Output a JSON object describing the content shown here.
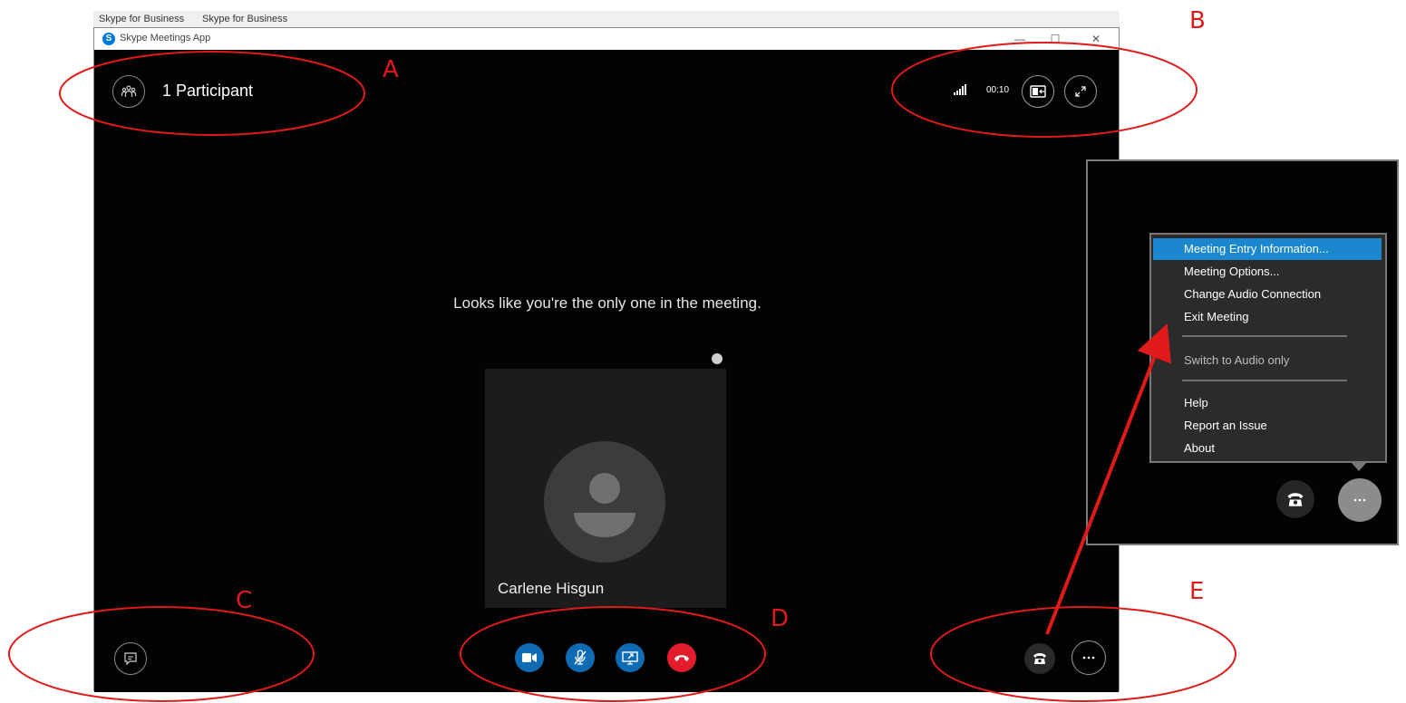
{
  "background_tabs": {
    "left_text": "Skype for Business",
    "right_text": "Skype for Business"
  },
  "window": {
    "title": "Skype Meetings App",
    "logo_letter": "S",
    "minimize": "—",
    "maximize": "☐",
    "close": "✕"
  },
  "header": {
    "participants_label": "1 Participant",
    "timer": "00:10",
    "icons": [
      "participants-icon",
      "signal-icon",
      "contact-card-icon",
      "expand-icon"
    ]
  },
  "main": {
    "empty_message": "Looks like you're the only one in the meeting.",
    "tile_name": "Carlene Hisgun"
  },
  "controls": {
    "video": "video-icon",
    "mic": "mic-muted-icon",
    "share": "share-screen-icon",
    "hangup": "hang-up-icon",
    "colors": {
      "blue": "#0f6bb3",
      "red": "#e21c2c"
    }
  },
  "menu": {
    "items": [
      {
        "label": "Meeting Entry Information...",
        "state": "selected"
      },
      {
        "label": "Meeting Options..."
      },
      {
        "label": "Change Audio Connection"
      },
      {
        "label": "Exit Meeting"
      },
      {
        "label": "Switch to Audio only",
        "state": "disabled"
      },
      {
        "label": "Help"
      },
      {
        "label": "Report an Issue"
      },
      {
        "label": "About"
      }
    ]
  },
  "annotations": {
    "A": "A",
    "B": "B",
    "C": "C",
    "D": "D",
    "E": "E"
  }
}
